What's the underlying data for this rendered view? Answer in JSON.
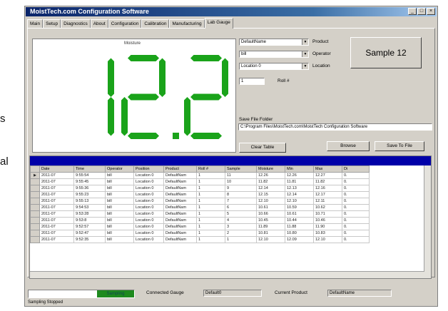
{
  "side": {
    "text1": "s",
    "text2": "al"
  },
  "window": {
    "title": "MoistTech.com Configuration Software"
  },
  "tabs": [
    "Main",
    "Setup",
    "Diagnostics",
    "About",
    "Configuration",
    "Calibration",
    "Manufacturing",
    "Lab Gauge"
  ],
  "active_tab": 7,
  "display": {
    "label": "Moisture",
    "value": "12.2",
    "color": "#1aa31a"
  },
  "controls": {
    "product_value": "DefaultName",
    "product_label": "Product",
    "operator_value": "bill",
    "operator_label": "Operator",
    "location_value": "Location 0",
    "location_label": "Location",
    "roll_value": "1",
    "roll_label": "Roll #",
    "sample_button": "Sample 12",
    "save_folder_label": "Save File Folder",
    "save_folder_value": "C:\\Program Files\\MoistTech.com\\MoistTech Configuration Software",
    "clear_button": "Clear Table",
    "browse_button": "Browse",
    "save_file_button": "Save To File"
  },
  "table": {
    "columns": [
      "Date",
      "Time",
      "Operator",
      "Position",
      "Product",
      "Roll #",
      "Sample",
      "Moisture",
      "Min",
      "Max",
      "Di"
    ],
    "rows": [
      [
        "2011-07",
        "9:55:54",
        "bill",
        "Location 0",
        "DefaultNam",
        "1",
        "11",
        "12.26",
        "12.26",
        "12.27",
        "0."
      ],
      [
        "2011-07",
        "9:55:45",
        "bill",
        "Location 0",
        "DefaultNam",
        "1",
        "10",
        "11.82",
        "11.81",
        "11.82",
        "0."
      ],
      [
        "2011-07",
        "9:55:36",
        "bill",
        "Location 0",
        "DefaultNam",
        "1",
        "9",
        "12.14",
        "12.13",
        "12.16",
        "0."
      ],
      [
        "2011-07",
        "9:55:23",
        "bill",
        "Location 0",
        "DefaultNam",
        "1",
        "8",
        "12.15",
        "12.14",
        "12.17",
        "0."
      ],
      [
        "2011-07",
        "9:55:13",
        "bill",
        "Location 0",
        "DefaultNam",
        "1",
        "7",
        "12.10",
        "12.10",
        "12.11",
        "0."
      ],
      [
        "2011-07",
        "9:54:53",
        "bill",
        "Location 0",
        "DefaultNam",
        "1",
        "6",
        "10.61",
        "10.59",
        "10.62",
        "0."
      ],
      [
        "2011-07",
        "9:53:28",
        "bill",
        "Location 0",
        "DefaultNam",
        "1",
        "5",
        "10.66",
        "10.61",
        "10.71",
        "0."
      ],
      [
        "2011-07",
        "9:53:8",
        "bill",
        "Location 0",
        "DefaultNam",
        "1",
        "4",
        "10.45",
        "10.44",
        "10.46",
        "0."
      ],
      [
        "2011-07",
        "9:52:57",
        "bill",
        "Location 0",
        "DefaultNam",
        "1",
        "3",
        "11.89",
        "11.88",
        "11.90",
        "0."
      ],
      [
        "2011-07",
        "9:52:47",
        "bill",
        "Location 0",
        "DefaultNam",
        "1",
        "2",
        "10.81",
        "10.80",
        "10.83",
        "0."
      ],
      [
        "2011-07",
        "9:52:35",
        "bill",
        "Location 0",
        "DefaultNam",
        "1",
        "1",
        "12.10",
        "12.09",
        "12.10",
        "0."
      ]
    ]
  },
  "status": {
    "progress_label": "Sampling",
    "connected_label": "Connected Gauge",
    "connected_value": "Default0",
    "current_product_label": "Current Product",
    "current_product_value": "DefaultName",
    "status_text": "Sampling Stopped"
  }
}
